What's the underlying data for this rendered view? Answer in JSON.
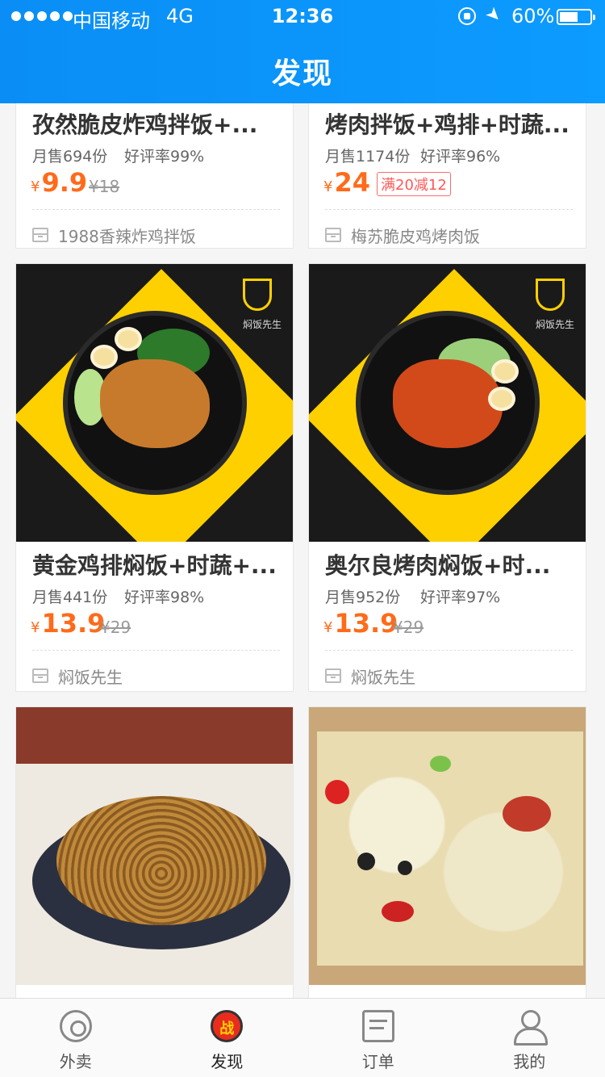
{
  "status_bar": {
    "carrier": "中国移动",
    "network": "4G",
    "time": "12:36",
    "battery": "60%"
  },
  "header": {
    "title": "发现"
  },
  "cards": [
    {
      "name": "孜然脆皮炸鸡拌饭+...",
      "sales": "月售694份",
      "rating": "好评率99%",
      "currency": "¥",
      "price": "9.9",
      "original_price": "¥18",
      "shop": "1988香辣炸鸡拌饭"
    },
    {
      "name": "烤肉拌饭+鸡排+时蔬...",
      "sales": "月售1174份",
      "rating": "好评率96%",
      "currency": "¥",
      "price": "24",
      "promo": "满20减12",
      "shop": "梅苏脆皮鸡烤肉饭"
    },
    {
      "name": "黄金鸡排焖饭+时蔬+...",
      "sales": "月售441份",
      "rating": "好评率98%",
      "currency": "¥",
      "price": "13.9",
      "original_price": "¥29",
      "shop": "焖饭先生",
      "logo_text": "焖饭先生"
    },
    {
      "name": "奥尔良烤肉焖饭+时...",
      "sales": "月售952份",
      "rating": "好评率97%",
      "currency": "¥",
      "price": "13.9",
      "original_price": "¥29",
      "shop": "焖饭先生",
      "logo_text": "焖饭先生"
    }
  ],
  "tabs": [
    {
      "label": "外卖",
      "icon": "takeout-icon"
    },
    {
      "label": "发现",
      "icon": "discover-icon",
      "active": true
    },
    {
      "label": "订单",
      "icon": "order-icon"
    },
    {
      "label": "我的",
      "icon": "profile-icon"
    }
  ],
  "colors": {
    "header": "#0c9bff",
    "price": "#ff6b1a",
    "promo": "#ff5a5a"
  }
}
